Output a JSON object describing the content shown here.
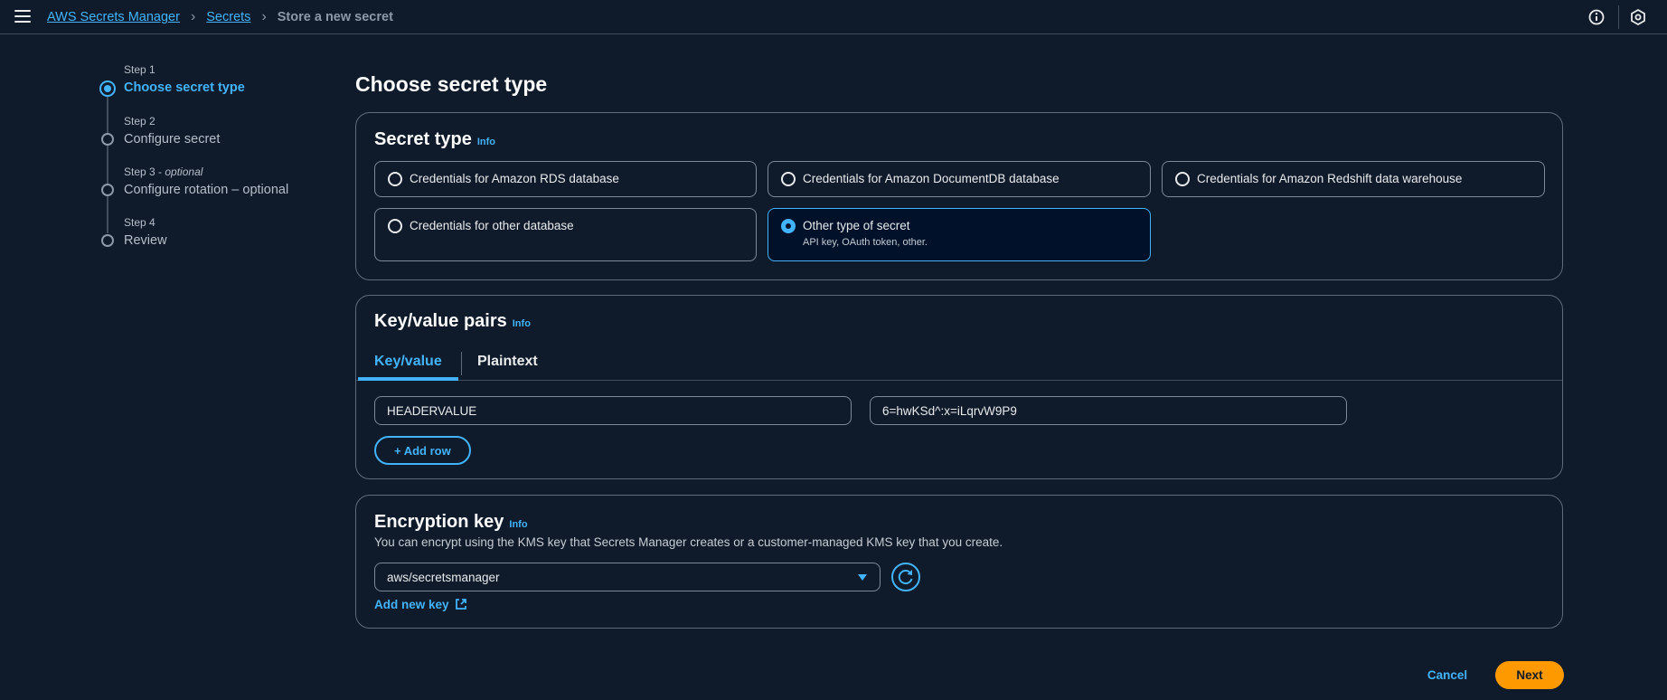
{
  "header": {
    "breadcrumbs": [
      "AWS Secrets Manager",
      "Secrets",
      "Store a new secret"
    ],
    "icons": [
      "menu-icon",
      "info-circle-icon",
      "settings-icon"
    ]
  },
  "steps": [
    {
      "small": "Step 1",
      "title": "Choose secret type",
      "active": true
    },
    {
      "small": "Step 2",
      "title": "Configure secret",
      "active": false
    },
    {
      "small": "Step 3",
      "optional": "optional",
      "title": "Configure rotation – optional",
      "active": false
    },
    {
      "small": "Step 4",
      "title": "Review",
      "active": false
    }
  ],
  "main": {
    "title": "Choose secret type",
    "secret_type": {
      "heading": "Secret type",
      "info": "Info",
      "options": [
        {
          "label": "Credentials for Amazon RDS database",
          "selected": false
        },
        {
          "label": "Credentials for Amazon DocumentDB database",
          "selected": false
        },
        {
          "label": "Credentials for Amazon Redshift data warehouse",
          "selected": false
        },
        {
          "label": "Credentials for other database",
          "selected": false
        },
        {
          "label": "Other type of secret",
          "description": "API key, OAuth token, other.",
          "selected": true
        }
      ]
    },
    "kv": {
      "heading": "Key/value pairs",
      "info": "Info",
      "tabs": [
        "Key/value",
        "Plaintext"
      ],
      "active_tab": "Key/value",
      "rows": [
        {
          "key": "HEADERVALUE",
          "value": "6=hwKSd^:x=iLqrvW9P9"
        }
      ],
      "add_row": "+ Add row"
    },
    "encryption": {
      "heading": "Encryption key",
      "info": "Info",
      "description": "You can encrypt using the KMS key that Secrets Manager creates or a customer-managed KMS key that you create.",
      "selected_key": "aws/secretsmanager",
      "add_new_key": "Add new key"
    }
  },
  "footer": {
    "cancel": "Cancel",
    "next": "Next"
  },
  "colors": {
    "accent": "#42b4ff",
    "primary_button": "#ff9900",
    "background": "#0f1b2a"
  }
}
